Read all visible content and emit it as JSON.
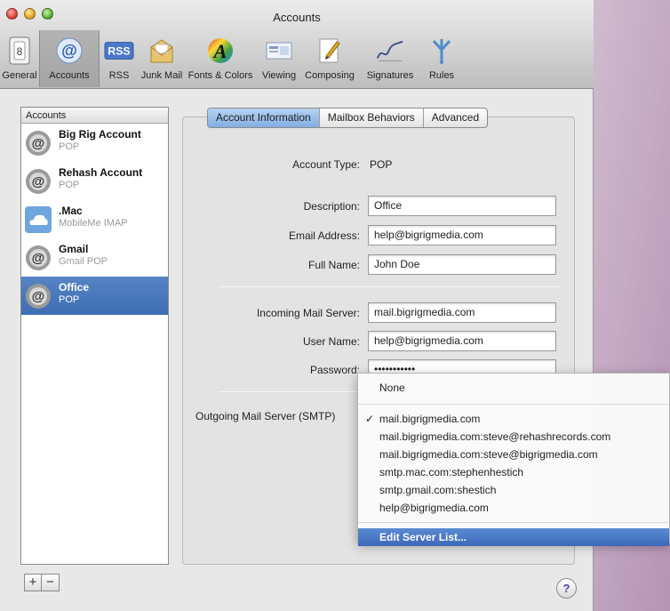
{
  "window": {
    "title": "Accounts"
  },
  "toolbar": {
    "items": [
      {
        "label": "General",
        "icon": "switch-icon"
      },
      {
        "label": "Accounts",
        "icon": "at-sign-icon"
      },
      {
        "label": "RSS",
        "icon": "rss-icon"
      },
      {
        "label": "Junk Mail",
        "icon": "junk-mail-icon"
      },
      {
        "label": "Fonts & Colors",
        "icon": "fonts-colors-icon"
      },
      {
        "label": "Viewing",
        "icon": "viewing-icon"
      },
      {
        "label": "Composing",
        "icon": "composing-icon"
      },
      {
        "label": "Signatures",
        "icon": "signature-icon"
      },
      {
        "label": "Rules",
        "icon": "rules-icon"
      }
    ],
    "selected": "Accounts"
  },
  "sidebar": {
    "header": "Accounts",
    "accounts": [
      {
        "name": "Big Rig Account",
        "type": "POP",
        "icon": "at-sign-icon"
      },
      {
        "name": "Rehash Account",
        "type": "POP",
        "icon": "at-sign-icon"
      },
      {
        "name": ".Mac",
        "type": "MobileMe IMAP",
        "icon": "cloud-icon"
      },
      {
        "name": "Gmail",
        "type": "Gmail POP",
        "icon": "at-sign-icon"
      },
      {
        "name": "Office",
        "type": "POP",
        "icon": "at-sign-icon"
      }
    ],
    "selected": "Office",
    "add_label": "+",
    "remove_label": "−"
  },
  "tabs": [
    {
      "label": "Account Information"
    },
    {
      "label": "Mailbox Behaviors"
    },
    {
      "label": "Advanced"
    }
  ],
  "form": {
    "account_type_label": "Account Type:",
    "account_type_value": "POP",
    "description_label": "Description:",
    "description_value": "Office",
    "email_label": "Email Address:",
    "email_value": "help@bigrigmedia.com",
    "fullname_label": "Full Name:",
    "fullname_value": "John Doe",
    "incoming_label": "Incoming Mail Server:",
    "incoming_value": "mail.bigrigmedia.com",
    "username_label": "User Name:",
    "username_value": "help@bigrigmedia.com",
    "password_label": "Password:",
    "password_value": "•••••••••••",
    "smtp_label": "Outgoing Mail Server (SMTP)"
  },
  "smtp_menu": {
    "none_label": "None",
    "check_mark": "✓",
    "items": [
      "mail.bigrigmedia.com",
      "mail.bigrigmedia.com:steve@rehashrecords.com",
      "mail.bigrigmedia.com:steve@bigrigmedia.com",
      "smtp.mac.com:stephenhestich",
      "smtp.gmail.com:shestich",
      "help@bigrigmedia.com"
    ],
    "checked": "mail.bigrigmedia.com",
    "edit_label": "Edit Server List..."
  },
  "help_label": "?",
  "colors": {
    "selection": "#3e6db4",
    "active_tab": "#82aee3"
  }
}
